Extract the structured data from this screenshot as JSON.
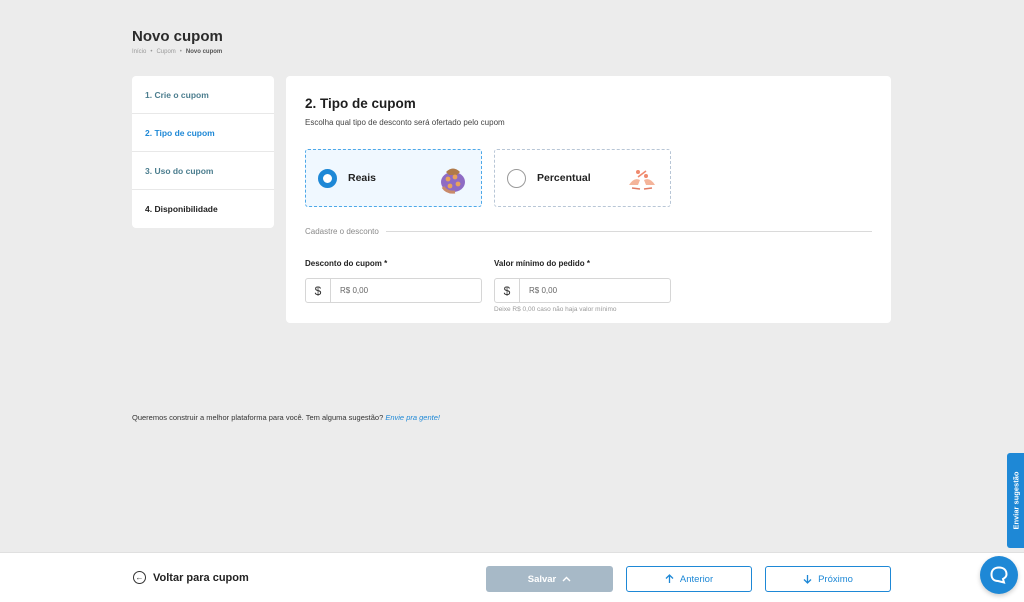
{
  "header": {
    "title": "Novo cupom",
    "breadcrumb": [
      "Início",
      "Cupom",
      "Novo cupom"
    ]
  },
  "steps": [
    {
      "label": "1.  Crie o cupom",
      "state": "completed"
    },
    {
      "label": "2.  Tipo de cupom",
      "state": "active"
    },
    {
      "label": "3.  Uso do cupom",
      "state": "upcoming"
    },
    {
      "label": "4.  Disponibilidade",
      "state": "upcoming"
    }
  ],
  "main": {
    "title": "2. Tipo de cupom",
    "subtitle": "Escolha qual tipo de desconto será ofertado pelo cupom",
    "options": [
      {
        "label": "Reais",
        "selected": true,
        "icon": "money-bag-illustration"
      },
      {
        "label": "Percentual",
        "selected": false,
        "icon": "hands-percent-illustration"
      }
    ],
    "section_label": "Cadastre o desconto",
    "fields": {
      "discount": {
        "label": "Desconto do cupom *",
        "prefix": "$",
        "placeholder": "R$ 0,00",
        "value": ""
      },
      "min_order": {
        "label": "Valor mínimo do pedido *",
        "prefix": "$",
        "placeholder": "R$ 0,00",
        "value": "",
        "hint": "Deixe R$ 0,00 caso não haja valor mínimo"
      }
    }
  },
  "feedback": {
    "text": "Queremos construir a melhor plataforma para você. Tem alguma sugestão?",
    "link": "Envie pra gente!"
  },
  "bottom_bar": {
    "back_label": "Voltar para cupom",
    "save_label": "Salvar",
    "prev_label": "Anterior",
    "next_label": "Próximo"
  },
  "side_tab": {
    "label": "Enviar sugestão"
  },
  "colors": {
    "accent": "#1e88d6",
    "save_button": "#a7b9c7",
    "background": "#ececec"
  }
}
